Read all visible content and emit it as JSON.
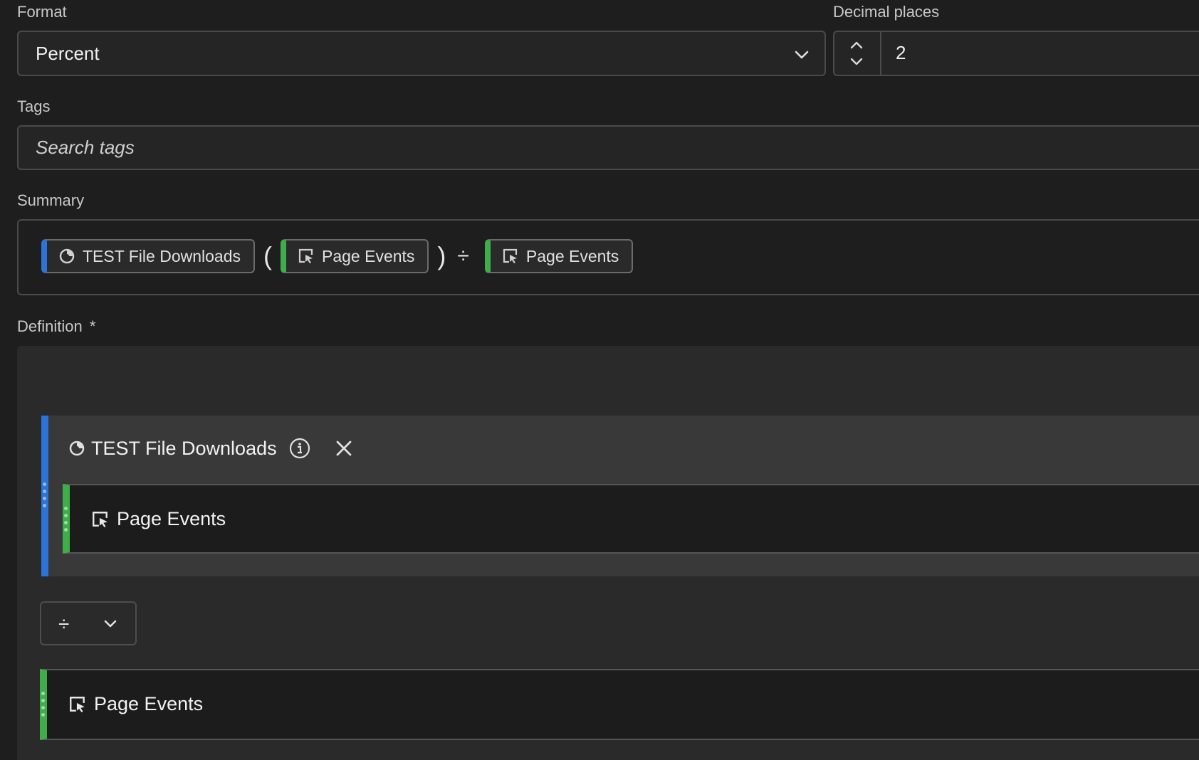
{
  "format": {
    "label": "Format",
    "value": "Percent"
  },
  "decimal": {
    "label": "Decimal places",
    "value": "2"
  },
  "tags": {
    "label": "Tags",
    "placeholder": "Search tags"
  },
  "summary": {
    "label": "Summary",
    "chip1": "TEST File Downloads",
    "open_paren": "(",
    "chip2": "Page Events",
    "close_paren": ")",
    "operator": "÷",
    "chip3": "Page Events"
  },
  "definition": {
    "label": "Definition",
    "required_mark": "*",
    "container_title": "TEST File Downloads",
    "nested_metric": "Page Events",
    "operator_symbol": "÷",
    "second_metric": "Page Events"
  },
  "colors": {
    "segment": "#2d74d9",
    "metric": "#3fae4a"
  }
}
